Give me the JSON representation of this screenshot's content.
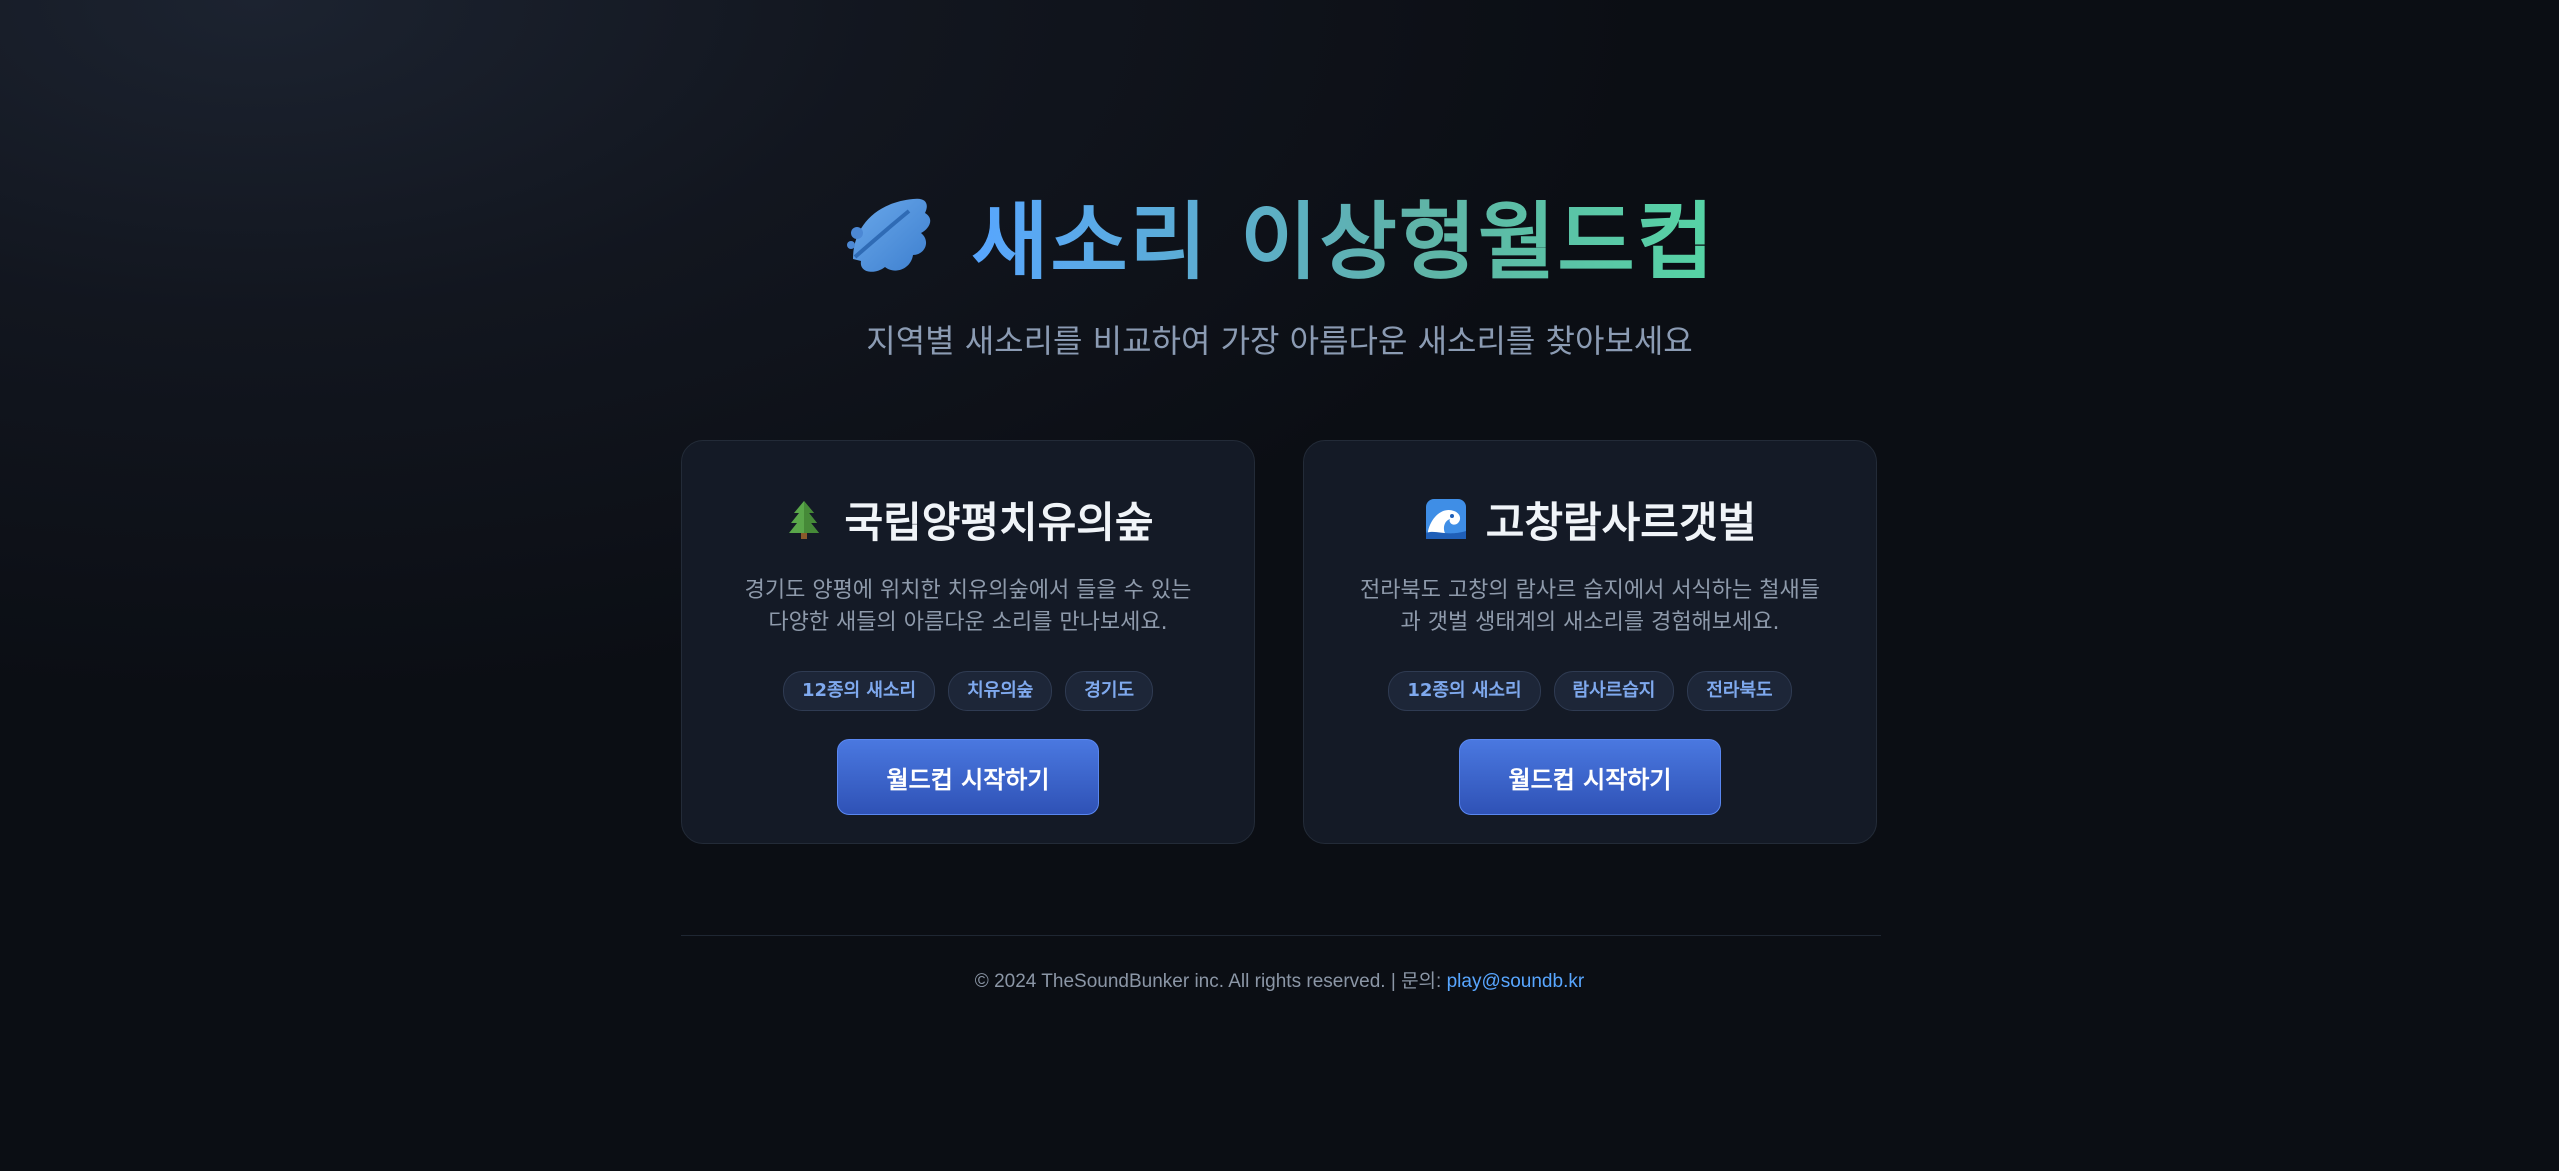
{
  "header": {
    "icon": "leaf-icon",
    "title": "새소리 이상형월드컵",
    "subtitle": "지역별 새소리를 비교하여 가장 아름다운 새소리를 찾아보세요"
  },
  "cards": [
    {
      "icon": "evergreen-tree-icon",
      "title": "국립양평치유의숲",
      "description_line1": "경기도 양평에 위치한 치유의숲에서 들을 수 있는",
      "description_line2": "다양한 새들의 아름다운 소리를 만나보세요.",
      "tags": [
        "12종의 새소리",
        "치유의숲",
        "경기도"
      ],
      "button_label": "월드컵 시작하기"
    },
    {
      "icon": "water-wave-icon",
      "title": "고창람사르갯벌",
      "description_line1": "전라북도 고창의 람사르 습지에서 서식하는 철새들",
      "description_line2": "과 갯벌 생태계의 새소리를 경험해보세요.",
      "tags": [
        "12종의 새소리",
        "람사르습지",
        "전라북도"
      ],
      "button_label": "월드컵 시작하기"
    }
  ],
  "footer": {
    "copyright": "© 2024 TheSoundBunker inc. All rights reserved. | 문의: ",
    "email": "play@soundb.kr"
  },
  "colors": {
    "accent": "#58a6ff",
    "button": "#3b63c9",
    "background": "#0d1117"
  }
}
